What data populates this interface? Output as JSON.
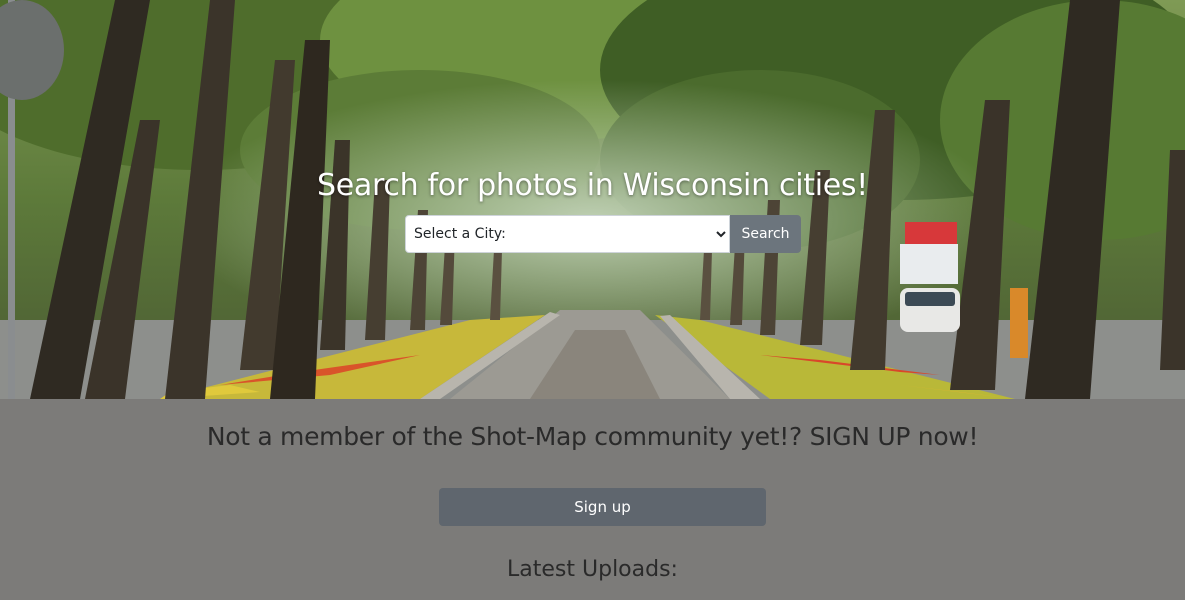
{
  "hero": {
    "title": "Search for photos in Wisconsin cities!",
    "city_select": {
      "selected": "Select a City:",
      "options": [
        "Select a City:"
      ]
    },
    "search_label": "Search"
  },
  "signup": {
    "prompt": "Not a member of the Shot-Map community yet!? SIGN UP now!",
    "button_label": "Sign up"
  },
  "uploads": {
    "heading": "Latest Uploads:"
  },
  "colors": {
    "page_background": "#7c7b79",
    "button_gray": "#6c757d",
    "signup_button": "#5f666e",
    "text_dark": "#2a2a2a"
  }
}
